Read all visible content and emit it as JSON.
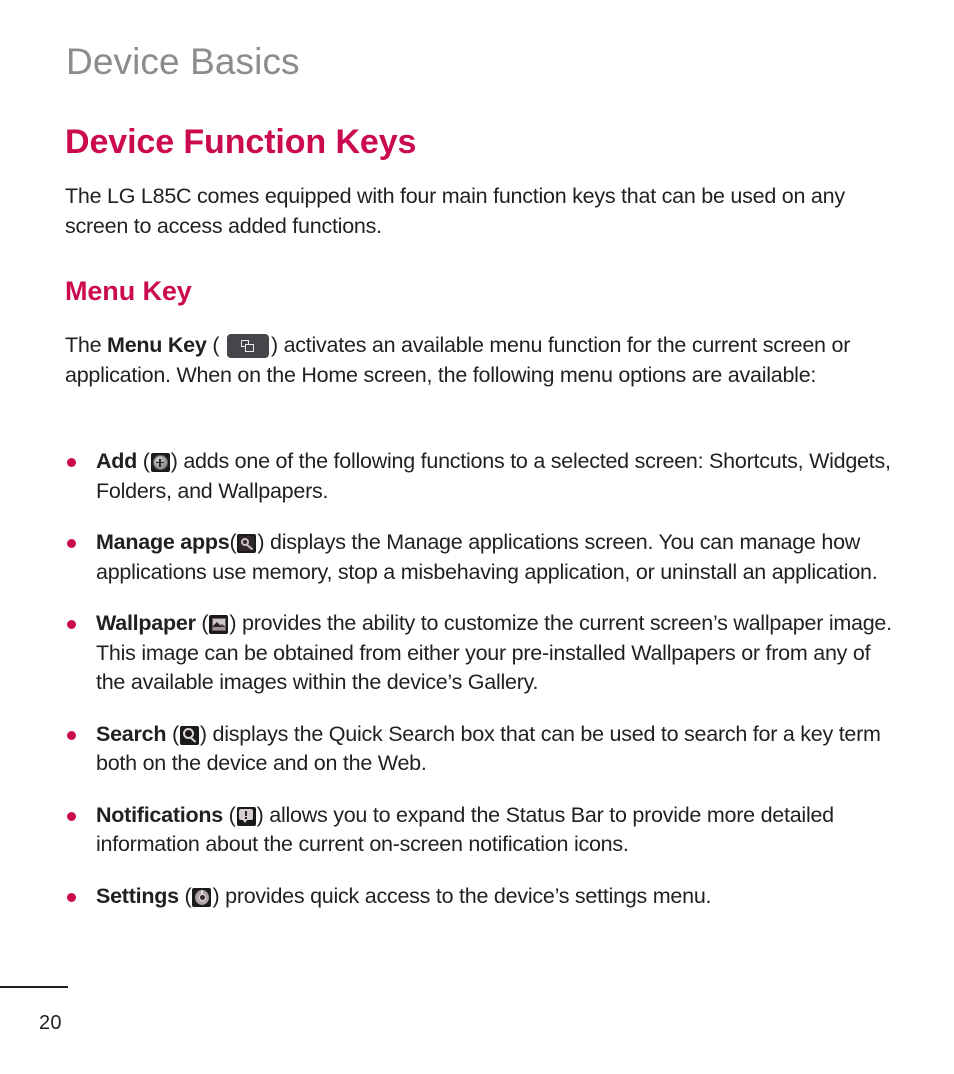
{
  "page": {
    "running_head": "Device Basics",
    "page_number": "20",
    "accent_color": "#cb0a4f",
    "running_head_color": "#8c8c8c",
    "body_color": "#231f20"
  },
  "section": {
    "title": "Device Function Keys",
    "intro": "The LG L85C comes equipped with four main function keys that can be used on any screen to access added functions."
  },
  "menu_key": {
    "heading": "Menu Key",
    "paragraph_before_icon": "The ",
    "bold_term": "Menu Key",
    "paren_open": " ( ",
    "icon_name": "menu-key-icon",
    "paren_close": ") ",
    "paragraph_after_icon": "activates an available menu function for the current screen or application. When on the Home screen, the following menu options are available:"
  },
  "options": [
    {
      "term": "Add",
      "paren_open": " (",
      "icon_name": "add-icon",
      "paren_close": ") ",
      "description": "adds one of the following functions to a selected screen: Shortcuts, Widgets, Folders, and Wallpapers."
    },
    {
      "term": "Manage apps",
      "paren_open": "(",
      "icon_name": "manage-apps-wrench-icon",
      "paren_close": ") ",
      "description": "displays the Manage applications screen. You can manage how applications use memory, stop a misbehaving application, or uninstall an application."
    },
    {
      "term": "Wallpaper",
      "paren_open": " (",
      "icon_name": "wallpaper-picture-icon",
      "paren_close": ") ",
      "description": "provides the ability to customize the current screen’s wallpaper image. This image can be obtained from either your pre-installed Wallpapers or from any of the available images within the device’s Gallery."
    },
    {
      "term": "Search",
      "paren_open": " (",
      "icon_name": "search-magnifier-icon",
      "paren_close": ") ",
      "description": "displays the Quick Search box that can be used to search for a key term both on the device and on the Web."
    },
    {
      "term": "Notifications",
      "paren_open": " (",
      "icon_name": "notifications-bubble-icon",
      "paren_close": ") ",
      "description": "allows you to expand the Status Bar to provide more detailed information about the current on-screen notification icons."
    },
    {
      "term": "Settings",
      "paren_open": " (",
      "icon_name": "settings-gear-icon",
      "paren_close": ") ",
      "description": "provides quick access to the device’s settings menu."
    }
  ]
}
